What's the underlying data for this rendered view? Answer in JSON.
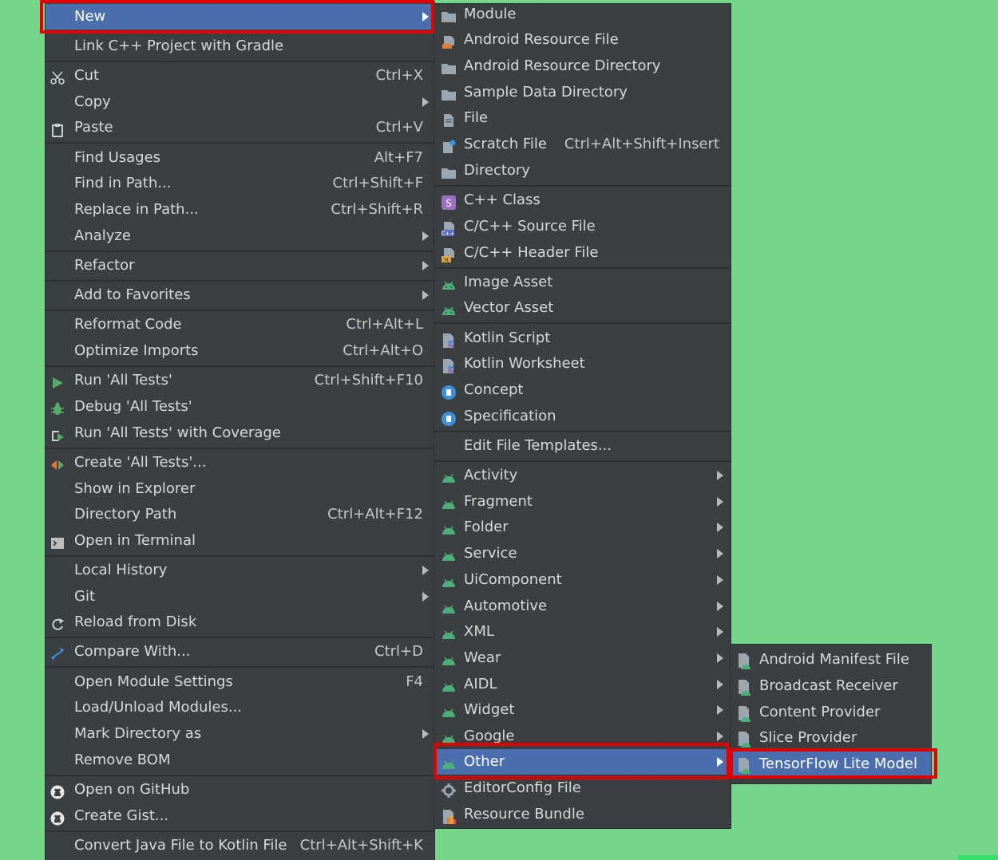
{
  "main_menu": [
    {
      "label": "New",
      "arrow": true,
      "highlighted": true
    },
    {
      "label": "Link C++ Project with Gradle"
    },
    {
      "label": "Cut",
      "shortcut": "Ctrl+X",
      "icon": "scissors-icon"
    },
    {
      "label": "Copy",
      "arrow": true
    },
    {
      "label": "Paste",
      "shortcut": "Ctrl+V",
      "icon": "clipboard-icon"
    },
    {
      "label": "Find Usages",
      "shortcut": "Alt+F7"
    },
    {
      "label": "Find in Path...",
      "shortcut": "Ctrl+Shift+F"
    },
    {
      "label": "Replace in Path...",
      "shortcut": "Ctrl+Shift+R"
    },
    {
      "label": "Analyze",
      "arrow": true
    },
    {
      "label": "Refactor",
      "arrow": true
    },
    {
      "label": "Add to Favorites",
      "arrow": true
    },
    {
      "label": "Reformat Code",
      "shortcut": "Ctrl+Alt+L"
    },
    {
      "label": "Optimize Imports",
      "shortcut": "Ctrl+Alt+O"
    },
    {
      "label": "Run 'All Tests'",
      "shortcut": "Ctrl+Shift+F10",
      "icon": "run-icon"
    },
    {
      "label": "Debug 'All Tests'",
      "icon": "debug-icon"
    },
    {
      "label": "Run 'All Tests' with Coverage",
      "icon": "coverage-icon"
    },
    {
      "label": "Create 'All Tests'...",
      "icon": "create-test-icon"
    },
    {
      "label": "Show in Explorer"
    },
    {
      "label": "Directory Path",
      "shortcut": "Ctrl+Alt+F12"
    },
    {
      "label": "Open in Terminal",
      "icon": "terminal-icon"
    },
    {
      "label": "Local History",
      "arrow": true
    },
    {
      "label": "Git",
      "arrow": true
    },
    {
      "label": "Reload from Disk",
      "icon": "reload-icon"
    },
    {
      "label": "Compare With...",
      "shortcut": "Ctrl+D",
      "icon": "compare-icon"
    },
    {
      "label": "Open Module Settings",
      "shortcut": "F4"
    },
    {
      "label": "Load/Unload Modules..."
    },
    {
      "label": "Mark Directory as",
      "arrow": true
    },
    {
      "label": "Remove BOM"
    },
    {
      "label": "Open on GitHub",
      "icon": "github-icon"
    },
    {
      "label": "Create Gist...",
      "icon": "github-icon"
    },
    {
      "label": "Convert Java File to Kotlin File",
      "shortcut": "Ctrl+Alt+Shift+K"
    }
  ],
  "new_menu": [
    {
      "label": "Module",
      "icon": "folder-icon"
    },
    {
      "label": "Android Resource File",
      "icon": "resource-file-icon"
    },
    {
      "label": "Android Resource Directory",
      "icon": "folder-icon"
    },
    {
      "label": "Sample Data Directory",
      "icon": "folder-icon"
    },
    {
      "label": "File",
      "icon": "file-icon"
    },
    {
      "label": "Scratch File",
      "shortcut": "Ctrl+Alt+Shift+Insert",
      "icon": "scratch-file-icon"
    },
    {
      "label": "Directory",
      "icon": "folder-icon"
    },
    {
      "label": "C++ Class",
      "icon": "cpp-class-icon"
    },
    {
      "label": "C/C++ Source File",
      "icon": "cpp-source-icon"
    },
    {
      "label": "C/C++ Header File",
      "icon": "cpp-header-icon"
    },
    {
      "label": "Image Asset",
      "icon": "android-icon"
    },
    {
      "label": "Vector Asset",
      "icon": "android-icon"
    },
    {
      "label": "Kotlin Script",
      "icon": "kotlin-icon"
    },
    {
      "label": "Kotlin Worksheet",
      "icon": "kotlin-icon"
    },
    {
      "label": "Concept",
      "icon": "concept-icon"
    },
    {
      "label": "Specification",
      "icon": "concept-icon"
    },
    {
      "label": "Edit File Templates..."
    },
    {
      "label": "Activity",
      "arrow": true,
      "icon": "android-icon"
    },
    {
      "label": "Fragment",
      "arrow": true,
      "icon": "android-icon"
    },
    {
      "label": "Folder",
      "arrow": true,
      "icon": "android-icon"
    },
    {
      "label": "Service",
      "arrow": true,
      "icon": "android-icon"
    },
    {
      "label": "UiComponent",
      "arrow": true,
      "icon": "android-icon"
    },
    {
      "label": "Automotive",
      "arrow": true,
      "icon": "android-icon"
    },
    {
      "label": "XML",
      "arrow": true,
      "icon": "android-icon"
    },
    {
      "label": "Wear",
      "arrow": true,
      "icon": "android-icon"
    },
    {
      "label": "AIDL",
      "arrow": true,
      "icon": "android-icon"
    },
    {
      "label": "Widget",
      "arrow": true,
      "icon": "android-icon"
    },
    {
      "label": "Google",
      "arrow": true,
      "icon": "android-icon"
    },
    {
      "label": "Other",
      "arrow": true,
      "icon": "android-icon",
      "highlighted": true
    },
    {
      "label": "EditorConfig File",
      "icon": "gear-icon"
    },
    {
      "label": "Resource Bundle",
      "icon": "resource-bundle-icon"
    }
  ],
  "other_menu": [
    {
      "label": "Android Manifest File",
      "icon": "android-file-icon"
    },
    {
      "label": "Broadcast Receiver",
      "icon": "android-file-icon"
    },
    {
      "label": "Content Provider",
      "icon": "android-file-icon"
    },
    {
      "label": "Slice Provider",
      "icon": "android-file-icon"
    },
    {
      "label": "TensorFlow Lite Model",
      "icon": "android-file-icon",
      "highlighted": true
    }
  ],
  "colors": {
    "background": "#74d68a",
    "menu_bg": "#3c3f41",
    "highlight": "#4b6eaf",
    "annotation": "#e00000",
    "android_green": "#4caf7a"
  }
}
